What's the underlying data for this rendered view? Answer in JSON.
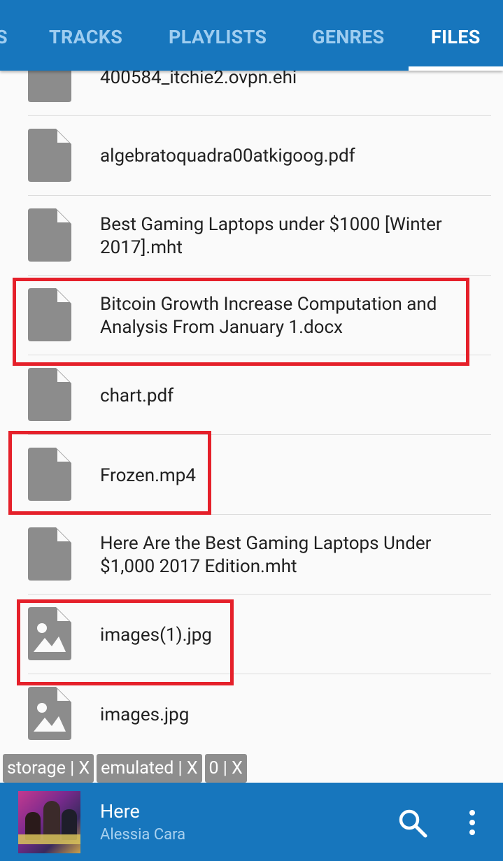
{
  "tabs": [
    {
      "label": "S",
      "active": false
    },
    {
      "label": "TRACKS",
      "active": false
    },
    {
      "label": "PLAYLISTS",
      "active": false
    },
    {
      "label": "GENRES",
      "active": false
    },
    {
      "label": "FILES",
      "active": true
    }
  ],
  "files": [
    {
      "name": "400584_itchie2.ovpn.ehi",
      "icon": "file-icon"
    },
    {
      "name": "algebratoquadra00atkigoog.pdf",
      "icon": "file-icon"
    },
    {
      "name": "Best Gaming Laptops under $1000 [Winter 2017].mht",
      "icon": "file-icon"
    },
    {
      "name": "Bitcoin Growth Increase Computation and Analysis From January 1.docx",
      "icon": "file-icon"
    },
    {
      "name": "chart.pdf",
      "icon": "file-icon"
    },
    {
      "name": "Frozen.mp4",
      "icon": "file-icon"
    },
    {
      "name": "Here Are the Best Gaming Laptops Under $1,000 2017 Edition.mht",
      "icon": "file-icon"
    },
    {
      "name": "images(1).jpg",
      "icon": "image-icon"
    },
    {
      "name": "images.jpg",
      "icon": "image-icon"
    }
  ],
  "breadcrumb": [
    "storage | X",
    "emulated | X",
    "0 | X"
  ],
  "now_playing": {
    "title": "Here",
    "artist": "Alessia Cara"
  },
  "colors": {
    "accent": "#1776bd",
    "highlight": "#e5202a",
    "icon_gray": "#8c8c8c"
  }
}
